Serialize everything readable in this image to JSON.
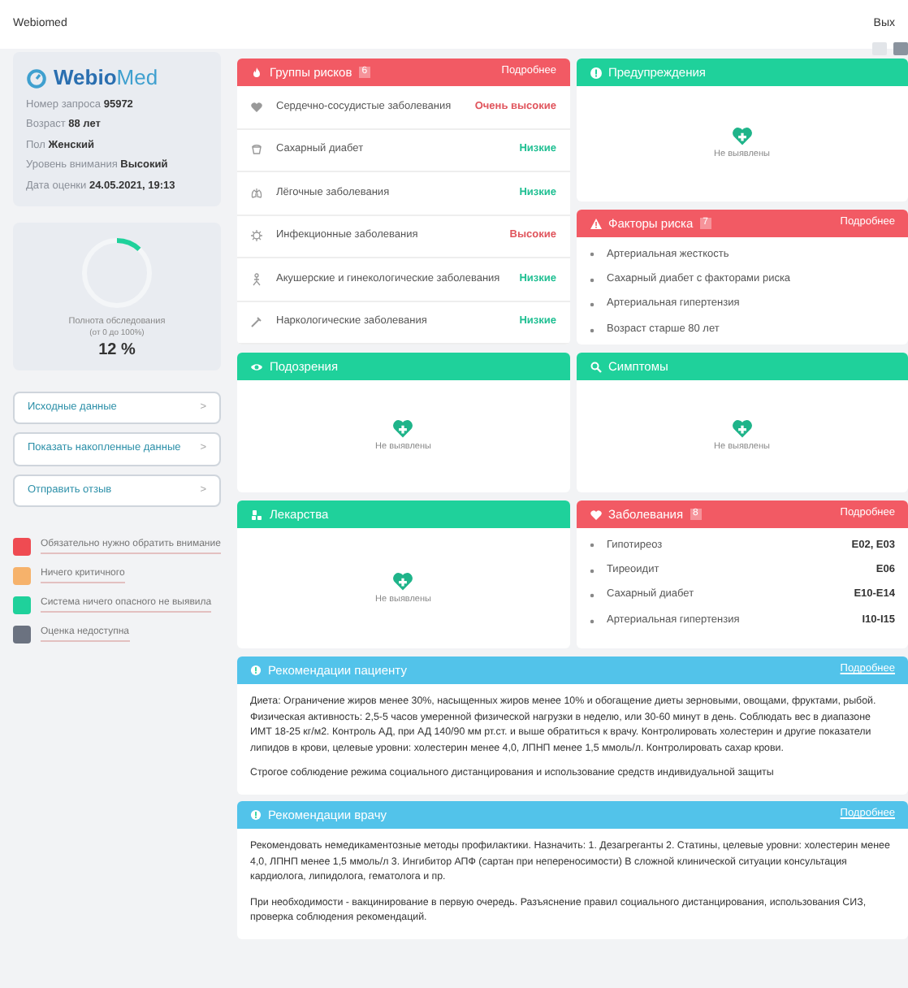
{
  "topbar": {
    "title": "Webiomed",
    "exit": "Вых"
  },
  "view_toggles": [
    {
      "selected": false
    },
    {
      "selected": true
    }
  ],
  "profile": {
    "logo_plain": "Webio",
    "logo_accent": "Med",
    "fields": [
      {
        "label": "Номер запроса",
        "value": "95972"
      },
      {
        "label": "Возраст",
        "value": "88 лет"
      },
      {
        "label": "Пол",
        "value": "Женский"
      },
      {
        "label": "Уровень внимания",
        "value": "Высокий"
      },
      {
        "label": "Дата оценки",
        "value": "24.05.2021, 19:13"
      }
    ]
  },
  "completeness": {
    "level": 0.12,
    "label": "Полнота обследования",
    "range": "(от 0 до 100%)",
    "value": "12 %"
  },
  "side_buttons": [
    {
      "label": "Исходные данные",
      "arrow": ">"
    },
    {
      "label": "Показать накопленные данные",
      "arrow": ">"
    },
    {
      "label": "Отправить отзыв",
      "arrow": ">"
    }
  ],
  "legend": [
    {
      "color": "#ef4b52",
      "text": "Обязательно нужно обратить внимание"
    },
    {
      "color": "#f6b26b",
      "text": "Ничего критичного"
    },
    {
      "color": "#1fd19b",
      "text": "Система ничего опасного не выявила"
    },
    {
      "color": "#6b7280",
      "text": "Оценка недоступна"
    }
  ],
  "panels": [
    {
      "kind": "risks",
      "color": "#f25a64",
      "title": "Группы рисков",
      "count": "6",
      "more": "Подробнее",
      "items": [
        {
          "name": "Сердечно-сосудистые заболевания",
          "value": "Очень высокие",
          "color": "#e0545c"
        },
        {
          "name": "Сахарный диабет",
          "value": "Низкие",
          "color": "#1fbf92"
        },
        {
          "name": "Лёгочные заболевания",
          "value": "Низкие",
          "color": "#1fbf92"
        },
        {
          "name": "Инфекционные заболевания",
          "value": "Высокие",
          "color": "#e0545c"
        },
        {
          "name": "Акушерские и гинекологические заболевания",
          "value": "Низкие",
          "color": "#1fbf92"
        },
        {
          "name": "Наркологические заболевания",
          "value": "Низкие",
          "color": "#1fbf92"
        }
      ]
    },
    {
      "kind": "empty",
      "color": "#1fd19b",
      "title": "Предупреждения",
      "empty": "Не выявлены"
    },
    {
      "kind": "bullets",
      "color": "#f25a64",
      "title": "Факторы риска",
      "count": "7",
      "more": "Подробнее",
      "items": [
        {
          "name": "Артериальная жесткость"
        },
        {
          "name": "Сахарный диабет с факторами риска"
        },
        {
          "name": "Артериальная гипертензия"
        },
        {
          "name": "Возраст старше 80 лет"
        }
      ]
    },
    {
      "kind": "empty",
      "color": "#1fd19b",
      "title": "Подозрения",
      "empty": "Не выявлены"
    },
    {
      "kind": "empty",
      "color": "#1fd19b",
      "title": "Симптомы",
      "empty": "Не выявлены"
    },
    {
      "kind": "empty",
      "color": "#1fd19b",
      "title": "Лекарства",
      "empty": "Не выявлены"
    },
    {
      "kind": "codes",
      "color": "#f25a64",
      "title": "Заболевания",
      "count": "8",
      "more": "Подробнее",
      "items": [
        {
          "name": "Гипотиреоз",
          "code": "E02, E03"
        },
        {
          "name": "Тиреоидит",
          "code": "E06"
        },
        {
          "name": "Сахарный диабет",
          "code": "E10-E14"
        },
        {
          "name": "Артериальная гипертензия",
          "code": "I10-I15"
        }
      ]
    }
  ],
  "recommendations": [
    {
      "title": "Рекомендации пациенту",
      "more": "Подробнее",
      "paragraphs": [
        "Диета: Ограничение жиров менее 30%, насыщенных жиров менее 10% и обогащение диеты зерновыми, овощами, фруктами, рыбой. Физическая активность: 2,5-5 часов умеренной физической нагрузки в неделю, или 30-60 минут в день. Соблюдать вес в диапазоне ИМТ 18-25 кг/м2.  Контроль АД, при АД 140/90 мм рт.ст. и выше обратиться к врачу. Контролировать холестерин и другие показатели липидов в крови, целевые уровни: холестерин менее 4,0, ЛПНП менее 1,5 ммоль/л. Контролировать сахар крови.",
        "Строгое соблюдение режима социального дистанцирования и использование средств индивидуальной защиты"
      ]
    },
    {
      "title": "Рекомендации врачу",
      "more": "Подробнее",
      "paragraphs": [
        "Рекомендовать немедикаментозные методы профилактики. Назначить: 1. Дезагреганты 2. Статины, целевые уровни: холестерин менее 4,0, ЛПНП менее 1,5 ммоль/л 3. Ингибитор АПФ (сартан при непереносимости) В сложной клинической ситуации консультация кардиолога, липидолога, гематолога и пр.",
        "При необходимости - вакцинирование в первую очередь. Разъяснение правил социального дистанцирования, использования СИЗ, проверка соблюдения рекомендаций."
      ]
    }
  ]
}
